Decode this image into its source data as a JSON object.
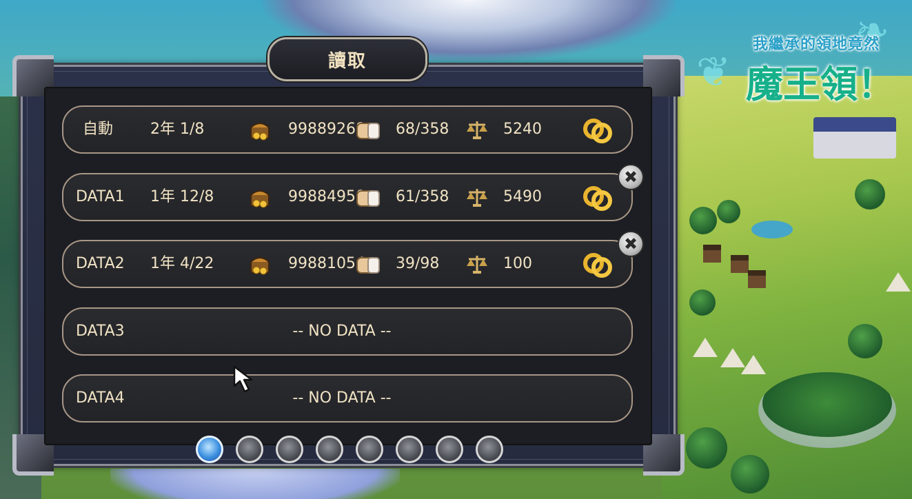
{
  "logo": {
    "subtitle": "我繼承的領地竟然",
    "title": "魔王領！"
  },
  "dialog": {
    "title": "讀取"
  },
  "icons": {
    "gold": "treasure-chest-icon",
    "food": "bread-icon",
    "reputation": "balance-scale-icon",
    "marriage": "rings-icon",
    "delete": "close-icon"
  },
  "slots": [
    {
      "name": "自動",
      "date": "2年 1/8",
      "gold": "99889268",
      "food": "68/358",
      "reputation": "5240"
    },
    {
      "name": "DATA1",
      "date": "1年 12/8",
      "gold": "99884950",
      "food": "61/358",
      "reputation": "5490"
    },
    {
      "name": "DATA2",
      "date": "1年 4/22",
      "gold": "99881054",
      "food": "39/98",
      "reputation": "100"
    },
    {
      "name": "DATA3",
      "empty_text": "-- NO DATA --"
    },
    {
      "name": "DATA4",
      "empty_text": "-- NO DATA --"
    }
  ],
  "pager": {
    "pages": 8,
    "current": 1
  },
  "colors": {
    "text": "#f1e3c4",
    "slot_border": "#a99786",
    "panel": "#1c1e23",
    "active_dot": "#3b8fe0"
  }
}
